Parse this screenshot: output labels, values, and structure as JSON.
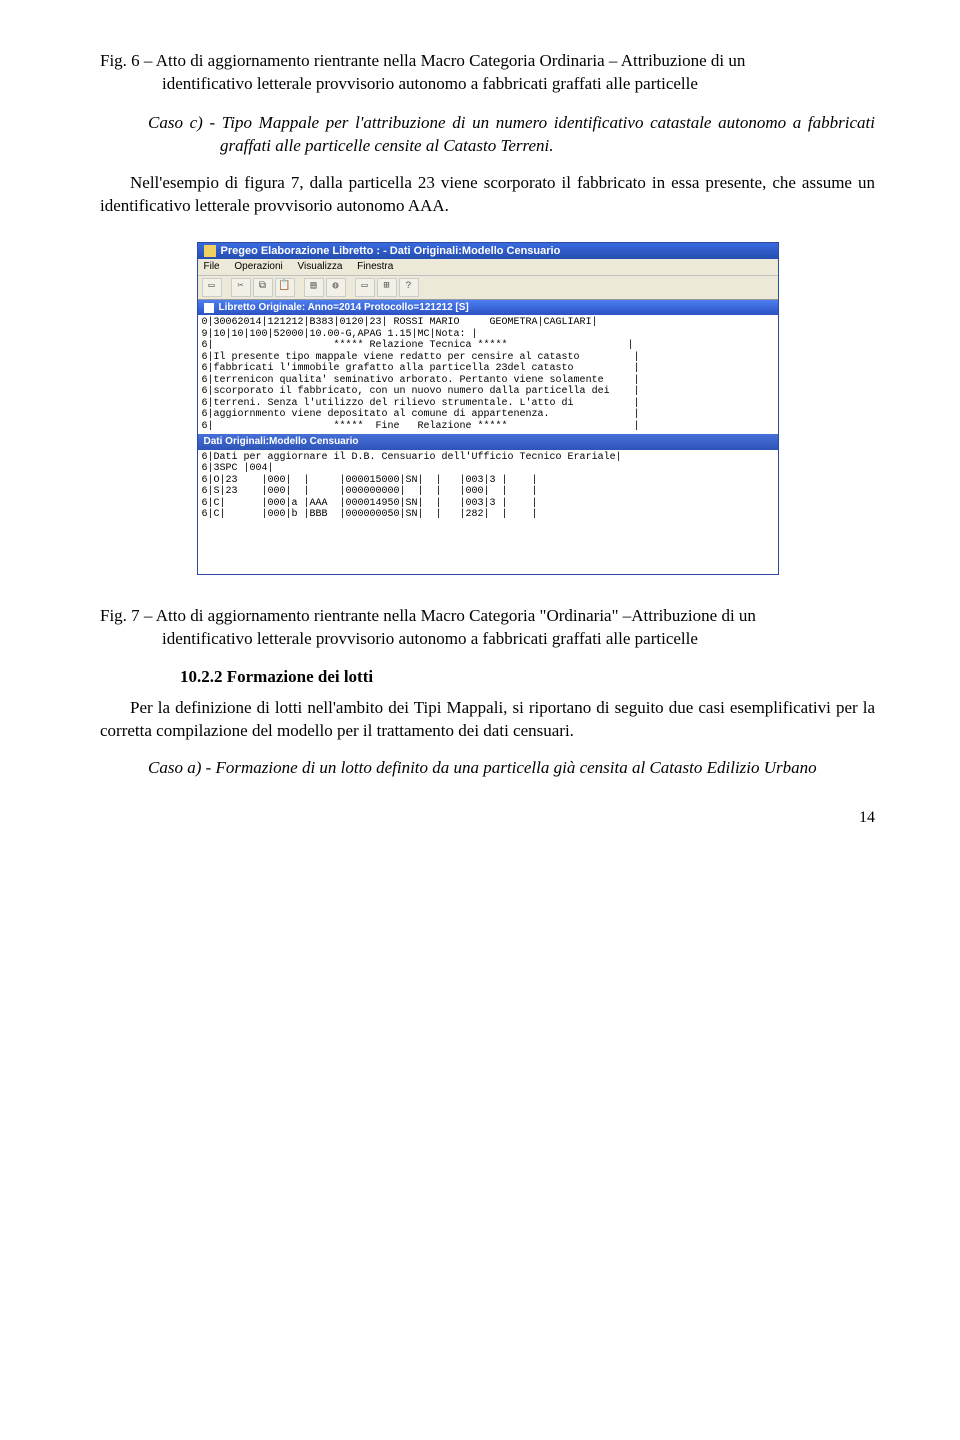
{
  "caption1_lead": "Fig. 6 – Atto di aggiornamento rientrante nella Macro Categoria Ordinaria – Attribuzione di un",
  "caption1_rest": "identificativo letterale provvisorio autonomo a fabbricati graffati alle particelle",
  "caso_c_lead": "Caso c) - ",
  "caso_c_text": "Tipo Mappale per l'attribuzione di un numero identificativo catastale autonomo a fabbricati graffati alle particelle censite al Catasto Terreni.",
  "para1": "Nell'esempio di figura 7, dalla particella 23 viene scorporato il fabbricato in essa presente, che assume un identificativo letterale provvisorio autonomo AAA.",
  "win": {
    "title": "Pregeo Elaborazione Libretto :  -  Dati Originali:Modello Censuario",
    "menu": [
      "File",
      "Operazioni",
      "Visualizza",
      "Finestra"
    ],
    "subtitle": "Libretto Originale: Anno=2014 Protocollo=121212 [S]",
    "pane1": "0|30062014|121212|B383|0120|23| ROSSI MARIO     GEOMETRA|CAGLIARI|\n9|10|10|100|52000|10.00-G,APAG 1.15|MC|Nota: |\n6|                    ***** Relazione Tecnica *****                    |\n6|Il presente tipo mappale viene redatto per censire al catasto         |\n6|fabbricati l'immobile grafatto alla particella 23del catasto          |\n6|terrenicon qualita' seminativo arborato. Pertanto viene solamente     |\n6|scorporato il fabbricato, con un nuovo numero dalla particella dei    |\n6|terreni. Senza l'utilizzo del rilievo strumentale. L'atto di          |\n6|aggiornmento viene depositato al comune di appartenenza.              |\n6|                    *****  Fine   Relazione *****                     |",
    "subhead": "Dati Originali:Modello Censuario",
    "pane2": "6|Dati per aggiornare il D.B. Censuario dell'Ufficio Tecnico Erariale|\n6|3SPC |004|\n6|O|23    |000|  |     |000015000|SN|  |   |003|3 |    |\n6|S|23    |000|  |     |000000000|  |  |   |000|  |    |\n6|C|      |000|a |AAA  |000014950|SN|  |   |003|3 |    |\n6|C|      |000|b |BBB  |000000050|SN|  |   |282|  |    |"
  },
  "caption2_lead": "Fig. 7 – Atto di aggiornamento rientrante nella Macro Categoria \"Ordinaria\" –Attribuzione di un",
  "caption2_rest": "identificativo letterale provvisorio autonomo a fabbricati graffati alle particelle",
  "sec_num": "10.2.2  Formazione dei lotti",
  "para2": "Per la definizione di lotti nell'ambito dei Tipi Mappali, si riportano di seguito due casi esemplificativi per la corretta compilazione del modello per il trattamento dei dati censuari.",
  "caso_a_lead": "Caso a) - ",
  "caso_a_text": "Formazione di un lotto definito da una particella già censita al Catasto Edilizio Urbano",
  "page_num": "14"
}
